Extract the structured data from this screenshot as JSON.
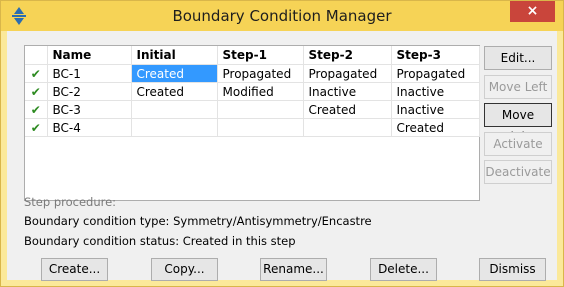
{
  "window": {
    "title": "Boundary Condition Manager",
    "close_glyph": "×"
  },
  "table": {
    "headers": [
      "",
      "Name",
      "Initial",
      "Step-1",
      "Step-2",
      "Step-3"
    ],
    "rows": [
      {
        "check": "✔",
        "name": "BC-1",
        "initial": "Created",
        "step1": "Propagated",
        "step2": "Propagated",
        "step3": "Propagated"
      },
      {
        "check": "✔",
        "name": "BC-2",
        "initial": "Created",
        "step1": "Modified",
        "step2": "Inactive",
        "step3": "Inactive"
      },
      {
        "check": "✔",
        "name": "BC-3",
        "initial": "",
        "step1": "",
        "step2": "Created",
        "step3": "Inactive"
      },
      {
        "check": "✔",
        "name": "BC-4",
        "initial": "",
        "step1": "",
        "step2": "",
        "step3": "Created"
      }
    ]
  },
  "side_buttons": {
    "edit": "Edit...",
    "move_left": "Move Left",
    "move_right": "Move Right",
    "activate": "Activate",
    "deactivate": "Deactivate"
  },
  "status": {
    "procedure_label": "Step procedure:",
    "type_text": "Boundary condition type:   Symmetry/Antisymmetry/Encastre",
    "status_text": "Boundary condition status: Created in this step"
  },
  "bottom_buttons": {
    "create": "Create...",
    "copy": "Copy...",
    "rename": "Rename...",
    "delete": "Delete...",
    "dismiss": "Dismiss"
  },
  "colors": {
    "accent": "#3399ff",
    "title_bar": "#f6d356",
    "check": "#2c8a20"
  },
  "icons": {
    "app": "abaqus-app-icon",
    "check": "check-icon"
  }
}
